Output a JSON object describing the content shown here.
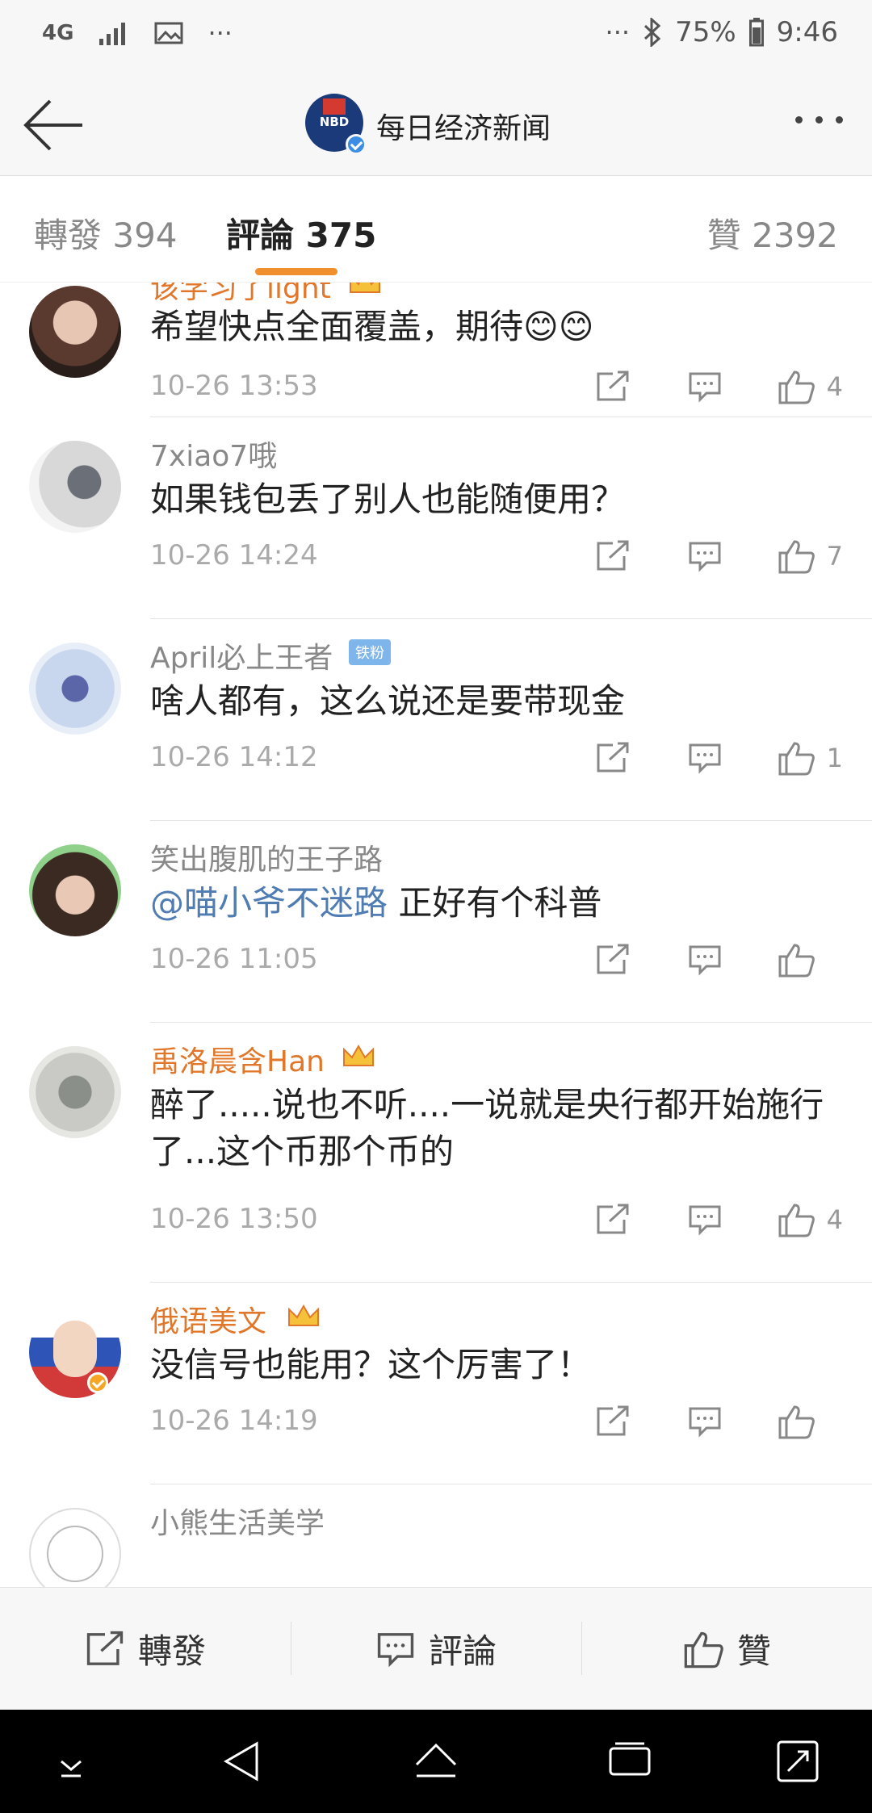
{
  "status_bar": {
    "network": "4G",
    "overflow": "···",
    "overflow_right": "···",
    "battery": "75%",
    "time": "9:46"
  },
  "header": {
    "account_name": "每日经济新闻",
    "logo_text": "NBD"
  },
  "tabs": {
    "repost": "轉發 394",
    "comments": "評論 375",
    "likes": "贊 2392"
  },
  "comments": [
    {
      "username": "该学习了light",
      "text": "希望快点全面覆盖，期待😊😊",
      "time": "10-26 13:53",
      "likes": "4"
    },
    {
      "username": "7xiao7哦",
      "text": "如果钱包丢了别人也能随便用？",
      "time": "10-26 14:24",
      "likes": "7"
    },
    {
      "username": "April必上王者",
      "badge": "铁粉",
      "text": "啥人都有，这么说还是要带现金",
      "time": "10-26 14:12",
      "likes": "1"
    },
    {
      "username": "笑出腹肌的王子路",
      "mention": "@喵小爷不迷路",
      "text": " 正好有个科普",
      "time": "10-26 11:05",
      "likes": ""
    },
    {
      "username": "禹洛晨含Han",
      "text": "醉了.....说也不听....一说就是央行都开始施行了...这个币那个币的",
      "time": "10-26 13:50",
      "likes": "4"
    },
    {
      "username": "俄语美文",
      "text": "没信号也能用？这个厉害了！",
      "time": "10-26 14:19",
      "likes": ""
    },
    {
      "username": "小熊生活美学"
    }
  ],
  "bottom_bar": {
    "repost": "轉發",
    "comment": "評論",
    "like": "贊"
  },
  "colors": {
    "accent": "#f08f2d",
    "vip_name": "#e0772a",
    "mention": "#4e7cb3"
  }
}
